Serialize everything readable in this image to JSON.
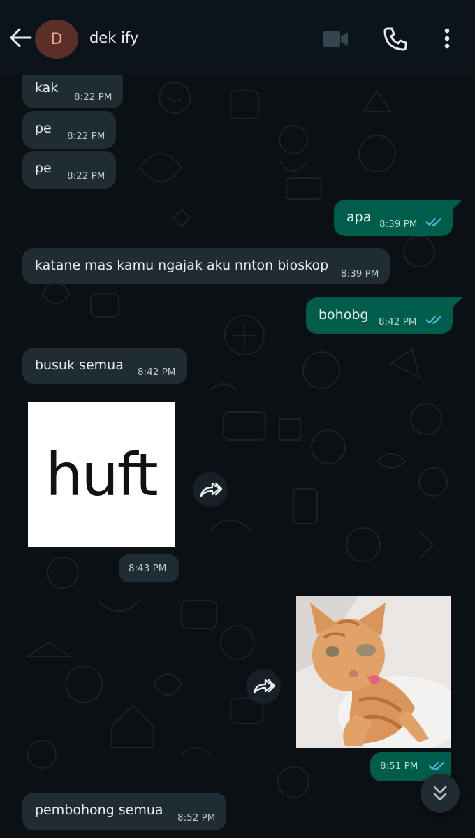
{
  "header": {
    "avatar_letter": "D",
    "contact_name": "dek ify",
    "icons": [
      "back-arrow-icon",
      "video-call-icon",
      "voice-call-icon",
      "more-options-icon"
    ]
  },
  "messages": [
    {
      "direction": "in",
      "text": "kak",
      "time": "8:22 PM"
    },
    {
      "direction": "in",
      "text": "pe",
      "time": "8:22 PM"
    },
    {
      "direction": "in",
      "text": "pe",
      "time": "8:22 PM"
    },
    {
      "direction": "out",
      "text": "apa",
      "time": "8:39 PM",
      "status": "read"
    },
    {
      "direction": "in",
      "text": "katane mas kamu ngajak aku nnton bioskop",
      "time": "8:39 PM"
    },
    {
      "direction": "out",
      "text": "bohobg",
      "time": "8:42 PM",
      "status": "read"
    },
    {
      "direction": "in",
      "text": "busuk semua",
      "time": "8:42 PM"
    },
    {
      "direction": "in",
      "type": "sticker",
      "sticker_text": "huft",
      "time": "8:43 PM"
    },
    {
      "direction": "out",
      "type": "sticker",
      "sticker": "orange cat",
      "time": "8:51 PM",
      "status": "read"
    },
    {
      "direction": "in",
      "text": "pembohong semua",
      "time": "8:52 PM"
    }
  ],
  "colors": {
    "background": "#0b1014",
    "incoming_bubble": "#202c33",
    "outgoing_bubble": "#005c4b",
    "read_tick": "#53bdeb"
  }
}
